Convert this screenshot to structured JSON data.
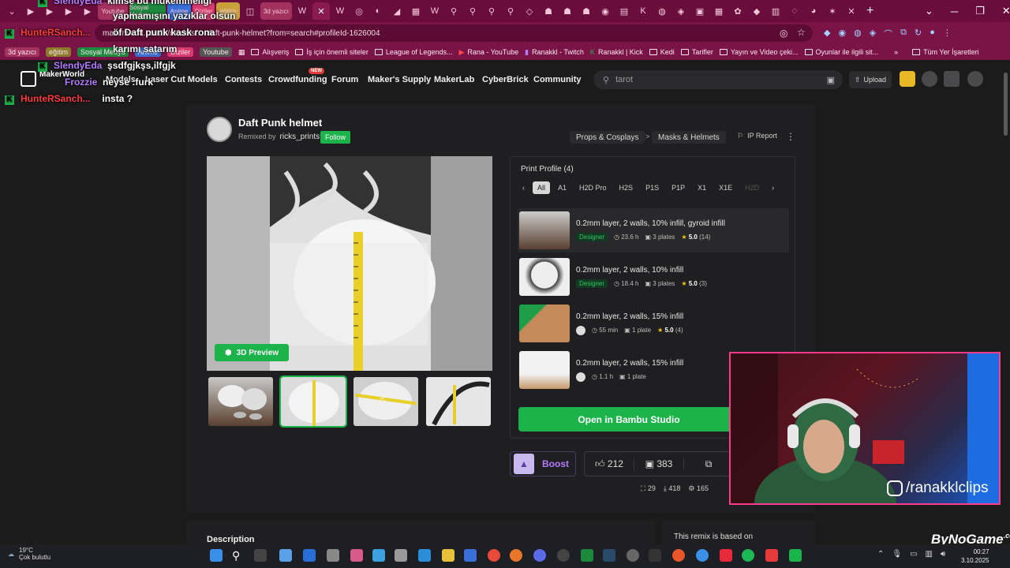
{
  "browser": {
    "url": "makerworld.com/tr/models/...-daft-punk-helmet?from=search#profileId-1626004",
    "tabs": [
      "Youtube",
      "Sosyal Medya",
      "Anime",
      "Diziler",
      "eğitim",
      "3d yazıcı"
    ],
    "new_tab": "+",
    "bookmarks": [
      "3d yazıcı",
      "eğitim",
      "Sosyal Medya",
      "Anime",
      "Diziler",
      "Youtube",
      "Alışveriş",
      "İş için önemli siteler",
      "League of Legends...",
      "Rana - YouTube",
      "Ranakkl - Twitch",
      "Ranakkl | Kick",
      "Kedi",
      "Tarifler",
      "Yayın ve Video çeki...",
      "Oyunlar ile ilgili sit..."
    ],
    "all_bookmarks": "Tüm Yer İşaretleri"
  },
  "nav": {
    "logo": "MakerWorld",
    "links": [
      "Models",
      "Laser Cut Models",
      "Contests",
      "Crowdfunding",
      "Forum",
      "Maker's Supply",
      "MakerLab",
      "CyberBrick",
      "Community"
    ],
    "new_badge": "NEW",
    "search_value": "tarot",
    "upload": "Upload"
  },
  "model": {
    "title": "Daft Punk helmet",
    "remixed_by_label": "Remixed by",
    "author": "ricks_prints",
    "follow": "Follow",
    "breadcrumb": [
      "Props & Cosplays",
      "Masks & Helmets"
    ],
    "ip_report": "IP Report",
    "preview_3d": "3D Preview"
  },
  "print_profile": {
    "title": "Print Profile (4)",
    "chips": [
      "All",
      "A1",
      "H2D Pro",
      "H2S",
      "P1S",
      "P1P",
      "X1",
      "X1E",
      "H2D"
    ],
    "profiles": [
      {
        "name": "0.2mm layer, 2 walls, 10% infill, gyroid infill",
        "designer": "Designer",
        "time": "23.6 h",
        "plates": "3 plates",
        "rating": "5.0",
        "count": "(14)"
      },
      {
        "name": "0.2mm layer, 2 walls, 10% infill",
        "designer": "Designer",
        "time": "18.4 h",
        "plates": "3 plates",
        "rating": "5.0",
        "count": "(3)"
      },
      {
        "name": "0.2mm layer, 2 walls, 15% infill",
        "designer": "",
        "time": "55 min",
        "plates": "1 plate",
        "rating": "5.0",
        "count": "(4)"
      },
      {
        "name": "0.2mm layer, 2 walls, 15% infill",
        "designer": "",
        "time": "1.1 h",
        "plates": "1 plate",
        "rating": "",
        "count": ""
      }
    ],
    "open_button": "Open in Bambu Studio"
  },
  "actions": {
    "boost": "Boost",
    "likes": "212",
    "collects": "383",
    "stats": [
      "29",
      "418",
      "165"
    ]
  },
  "footer_sections": {
    "description": "Description",
    "remix_based": "This remix is based on"
  },
  "stream": {
    "instagram": "/ranakklclips",
    "watermark": "ByNoGame",
    "watermark_suffix": ".com",
    "chat": [
      {
        "user": "SlendyEda",
        "msg": "kimse bu mükemmeliği",
        "color": "#b57bff"
      },
      {
        "user": "",
        "msg": "yapmamışını yazıklar olsun",
        "color": "#b57bff"
      },
      {
        "user": "HunteRSanch...",
        "msg": "öf Daft punk kask rona",
        "color": "#ff3b3b"
      },
      {
        "user": "",
        "msg": "karımı satarım",
        "color": "#ff3b3b"
      },
      {
        "user": "SlendyEda",
        "msg": "şsdfgjkşs,ilfgjk",
        "color": "#b57bff"
      },
      {
        "user": "Frozzie",
        "msg": "neyse :furk",
        "color": "#b57bff"
      },
      {
        "user": "HunteRSanch...",
        "msg": "insta ?",
        "color": "#ff3b3b"
      }
    ]
  },
  "taskbar": {
    "temp": "19°C",
    "weather": "Çok bulutlu",
    "time": "00:27",
    "date": "3.10.2025"
  }
}
